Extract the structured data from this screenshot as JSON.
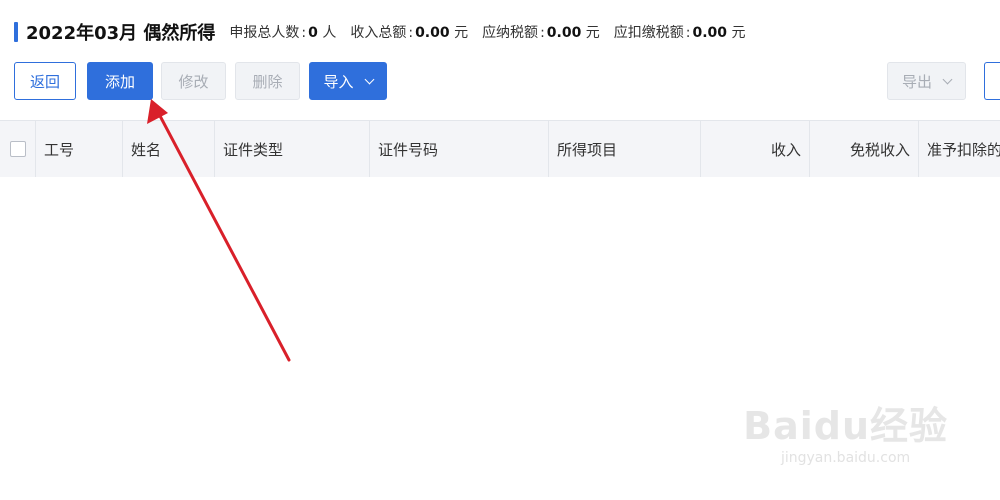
{
  "header": {
    "title": "2022年03月  偶然所得",
    "stats": [
      {
        "label": "申报总人数",
        "sep": ":",
        "value": "0",
        "unit": "人"
      },
      {
        "label": "收入总额",
        "sep": ":",
        "value": "0.00",
        "unit": "元"
      },
      {
        "label": "应纳税额",
        "sep": ":",
        "value": "0.00",
        "unit": "元"
      },
      {
        "label": "应扣缴税额",
        "sep": ":",
        "value": "0.00",
        "unit": "元"
      }
    ]
  },
  "toolbar": {
    "back_label": "返回",
    "add_label": "添加",
    "edit_label": "修改",
    "delete_label": "删除",
    "import_label": "导入",
    "export_label": "导出"
  },
  "table": {
    "columns": [
      "工号",
      "姓名",
      "证件类型",
      "证件号码",
      "所得项目",
      "收入",
      "免税收入",
      "准予扣除的"
    ],
    "rows": []
  },
  "watermark": {
    "logo_text": "Baidu经验",
    "url": "jingyan.baidu.com"
  },
  "colors": {
    "accent": "#2f6fdc",
    "annotation_arrow": "#d9202a"
  },
  "icons": [
    "chevron-down-icon",
    "checkbox-icon",
    "annotation-arrow"
  ]
}
